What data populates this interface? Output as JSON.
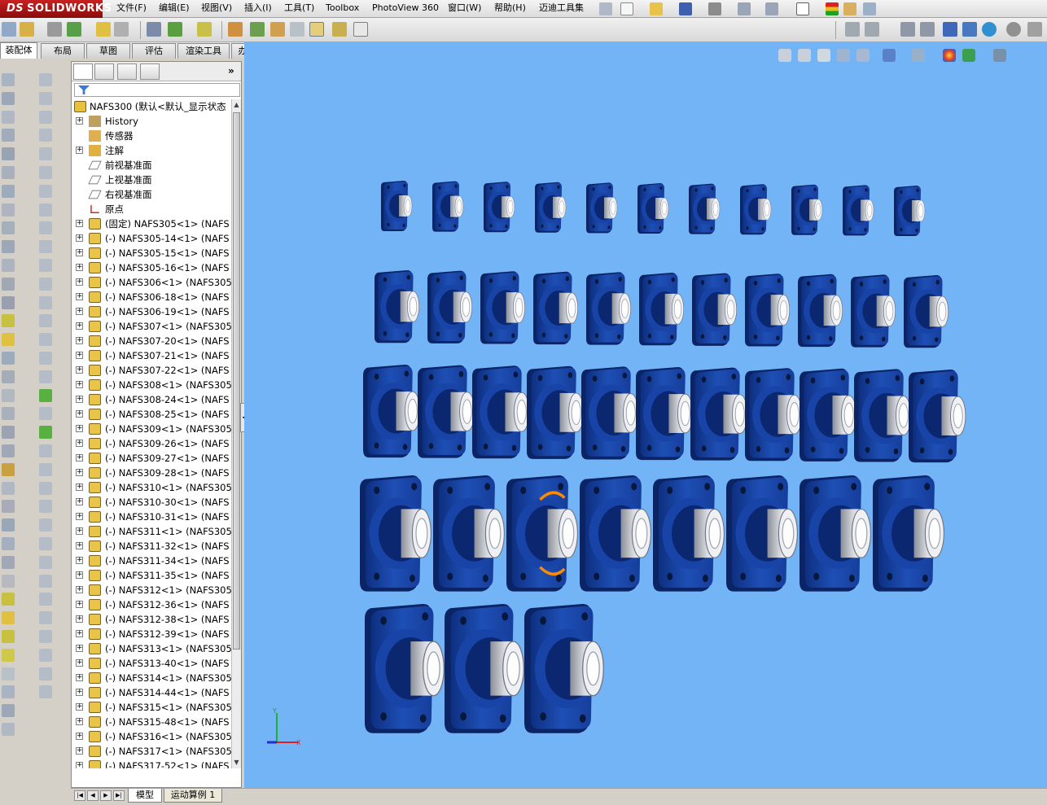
{
  "app": {
    "logo_prefix": "DS",
    "logo_text": "SOLIDWORKS"
  },
  "menu": [
    {
      "key": "file",
      "label": "文件(F)"
    },
    {
      "key": "edit",
      "label": "编辑(E)"
    },
    {
      "key": "view",
      "label": "视图(V)"
    },
    {
      "key": "insert",
      "label": "插入(I)"
    },
    {
      "key": "tools",
      "label": "工具(T)"
    },
    {
      "key": "toolbox",
      "label": "Toolbox"
    },
    {
      "key": "photoview",
      "label": "PhotoView 360"
    },
    {
      "key": "window",
      "label": "窗口(W)"
    },
    {
      "key": "help",
      "label": "帮助(H)"
    },
    {
      "key": "maidi",
      "label": "迈迪工具集"
    }
  ],
  "command_tabs": [
    {
      "key": "assembly",
      "label": "装配体",
      "active": true
    },
    {
      "key": "layout",
      "label": "布局",
      "active": false
    },
    {
      "key": "sketch",
      "label": "草图",
      "active": false
    },
    {
      "key": "evaluate",
      "label": "评估",
      "active": false
    },
    {
      "key": "render",
      "label": "渲染工具",
      "active": false
    },
    {
      "key": "office",
      "label": "办公室产品",
      "active": false
    }
  ],
  "feature_tree": {
    "expand_glyph": "+",
    "root": {
      "label": "NAFS300  (默认<默认_显示状态",
      "icon": "assembly-icon"
    },
    "items": [
      {
        "label": "History",
        "icon": "history-icon",
        "expandable": true
      },
      {
        "label": "传感器",
        "icon": "sensor-icon",
        "expandable": false
      },
      {
        "label": "注解",
        "icon": "annotation-icon",
        "expandable": true
      },
      {
        "label": "前视基准面",
        "icon": "plane-icon",
        "expandable": false
      },
      {
        "label": "上视基准面",
        "icon": "plane-icon",
        "expandable": false
      },
      {
        "label": "右视基准面",
        "icon": "plane-icon",
        "expandable": false
      },
      {
        "label": "原点",
        "icon": "origin-icon",
        "expandable": false
      },
      {
        "label": "(固定) NAFS305<1> (NAFS",
        "icon": "part-icon",
        "expandable": true
      },
      {
        "label": "(-) NAFS305-14<1> (NAFS",
        "icon": "part-icon",
        "expandable": true
      },
      {
        "label": "(-) NAFS305-15<1> (NAFS",
        "icon": "part-icon",
        "expandable": true
      },
      {
        "label": "(-) NAFS305-16<1> (NAFS",
        "icon": "part-icon",
        "expandable": true
      },
      {
        "label": "(-) NAFS306<1> (NAFS305",
        "icon": "part-icon",
        "expandable": true
      },
      {
        "label": "(-) NAFS306-18<1> (NAFS",
        "icon": "part-icon",
        "expandable": true
      },
      {
        "label": "(-) NAFS306-19<1> (NAFS",
        "icon": "part-icon",
        "expandable": true
      },
      {
        "label": "(-) NAFS307<1> (NAFS305",
        "icon": "part-icon",
        "expandable": true
      },
      {
        "label": "(-) NAFS307-20<1> (NAFS",
        "icon": "part-icon",
        "expandable": true
      },
      {
        "label": "(-) NAFS307-21<1> (NAFS",
        "icon": "part-icon",
        "expandable": true
      },
      {
        "label": "(-) NAFS307-22<1> (NAFS",
        "icon": "part-icon",
        "expandable": true
      },
      {
        "label": "(-) NAFS308<1> (NAFS305",
        "icon": "part-icon",
        "expandable": true
      },
      {
        "label": "(-) NAFS308-24<1> (NAFS",
        "icon": "part-icon",
        "expandable": true
      },
      {
        "label": "(-) NAFS308-25<1> (NAFS",
        "icon": "part-icon",
        "expandable": true
      },
      {
        "label": "(-) NAFS309<1> (NAFS305",
        "icon": "part-icon",
        "expandable": true
      },
      {
        "label": "(-) NAFS309-26<1> (NAFS",
        "icon": "part-icon",
        "expandable": true
      },
      {
        "label": "(-) NAFS309-27<1> (NAFS",
        "icon": "part-icon",
        "expandable": true
      },
      {
        "label": "(-) NAFS309-28<1> (NAFS",
        "icon": "part-icon",
        "expandable": true
      },
      {
        "label": "(-) NAFS310<1> (NAFS305",
        "icon": "part-icon",
        "expandable": true
      },
      {
        "label": "(-) NAFS310-30<1> (NAFS",
        "icon": "part-icon",
        "expandable": true
      },
      {
        "label": "(-) NAFS310-31<1> (NAFS",
        "icon": "part-icon",
        "expandable": true
      },
      {
        "label": "(-) NAFS311<1> (NAFS305",
        "icon": "part-icon",
        "expandable": true
      },
      {
        "label": "(-) NAFS311-32<1> (NAFS",
        "icon": "part-icon",
        "expandable": true
      },
      {
        "label": "(-) NAFS311-34<1> (NAFS",
        "icon": "part-icon",
        "expandable": true
      },
      {
        "label": "(-) NAFS311-35<1> (NAFS",
        "icon": "part-icon",
        "expandable": true
      },
      {
        "label": "(-) NAFS312<1> (NAFS305",
        "icon": "part-icon",
        "expandable": true
      },
      {
        "label": "(-) NAFS312-36<1> (NAFS",
        "icon": "part-icon",
        "expandable": true
      },
      {
        "label": "(-) NAFS312-38<1> (NAFS",
        "icon": "part-icon",
        "expandable": true
      },
      {
        "label": "(-) NAFS312-39<1> (NAFS",
        "icon": "part-icon",
        "expandable": true
      },
      {
        "label": "(-) NAFS313<1> (NAFS305",
        "icon": "part-icon",
        "expandable": true
      },
      {
        "label": "(-) NAFS313-40<1> (NAFS",
        "icon": "part-icon",
        "expandable": true
      },
      {
        "label": "(-) NAFS314<1> (NAFS305",
        "icon": "part-icon",
        "expandable": true
      },
      {
        "label": "(-) NAFS314-44<1> (NAFS",
        "icon": "part-icon",
        "expandable": true
      },
      {
        "label": "(-) NAFS315<1> (NAFS305",
        "icon": "part-icon",
        "expandable": true
      },
      {
        "label": "(-) NAFS315-48<1> (NAFS",
        "icon": "part-icon",
        "expandable": true
      },
      {
        "label": "(-) NAFS316<1> (NAFS305",
        "icon": "part-icon",
        "expandable": true
      },
      {
        "label": "(-) NAFS317<1> (NAFS305",
        "icon": "part-icon",
        "expandable": true
      },
      {
        "label": "(-) NAFS317-52<1> (NAFS",
        "icon": "part-icon",
        "expandable": true
      }
    ]
  },
  "bottom_tabs": [
    {
      "key": "model",
      "label": "模型",
      "active": true
    },
    {
      "key": "motion",
      "label": "运动算例 1",
      "active": false
    }
  ],
  "viewport": {
    "background_color": "#73b4f6",
    "part_color": "#1e4fb5",
    "insert_color": "#d6d9de",
    "selection_color": "#ff8a00",
    "rows_of_parts": [
      11,
      11,
      11,
      8,
      3
    ],
    "axis_labels": {
      "x": "X",
      "y": "Y"
    }
  }
}
